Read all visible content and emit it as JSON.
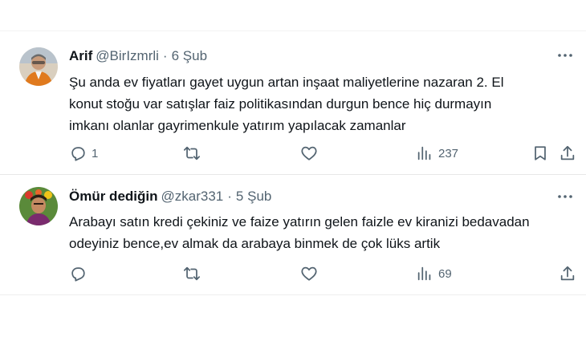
{
  "tweets": [
    {
      "name": "Arif",
      "handle": "@BirIzmrli",
      "separator": "·",
      "date": "6 Şub",
      "lines": [
        "Şu anda ev fiyatları gayet uygun artan inşaat maliyetlerine nazaran 2. El",
        "konut stoğu var satışlar faiz politikasından durgun bence hiç durmayın",
        "imkanı olanlar gayrimenkule yatırım yapılacak zamanlar"
      ],
      "replies": "1",
      "retweets": "",
      "likes": "",
      "views": "237"
    },
    {
      "name": "Ömür dediğin",
      "handle": "@zkar331",
      "separator": "·",
      "date": "5 Şub",
      "lines": [
        "Arabayı satın kredi çekiniz ve faize yatırın gelen faizle ev kiranizi bedavadan",
        "odeyiniz bence,ev almak da arabaya binmek de çok lüks artik"
      ],
      "replies": "",
      "retweets": "",
      "likes": "",
      "views": "69"
    }
  ],
  "icons": [
    "more-icon",
    "reply-icon",
    "retweet-icon",
    "like-icon",
    "views-icon",
    "bookmark-icon",
    "share-icon"
  ],
  "colors": {
    "text": "#0f1419",
    "secondary": "#536471",
    "divider": "#eff3f4"
  }
}
